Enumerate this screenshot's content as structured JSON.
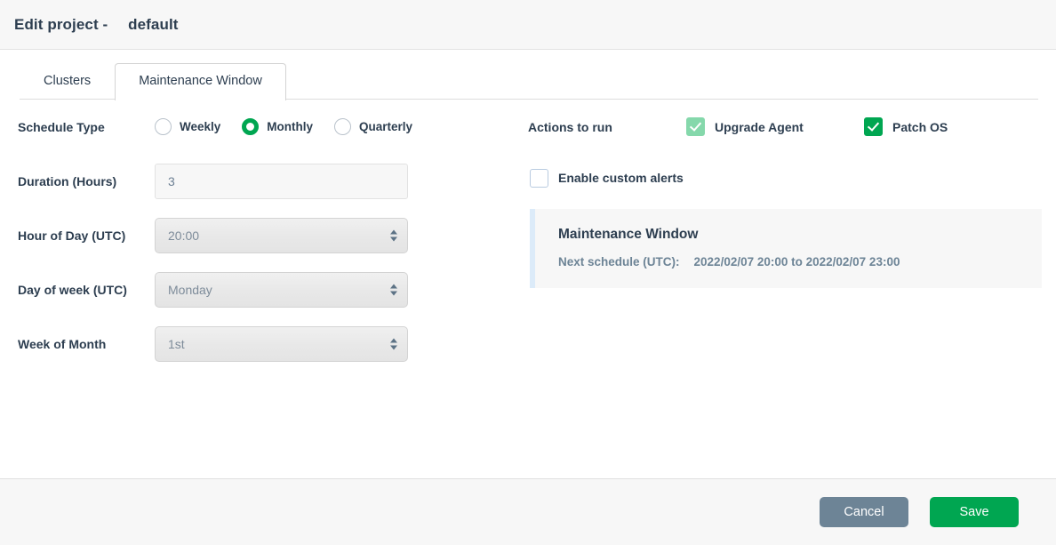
{
  "header": {
    "title_prefix": "Edit project -",
    "project_name": "default"
  },
  "tabs": [
    {
      "label": "Clusters",
      "active": false
    },
    {
      "label": "Maintenance Window",
      "active": true
    }
  ],
  "form": {
    "schedule_type": {
      "label": "Schedule Type",
      "options": [
        {
          "label": "Weekly",
          "selected": false
        },
        {
          "label": "Monthly",
          "selected": true
        },
        {
          "label": "Quarterly",
          "selected": false
        }
      ]
    },
    "duration": {
      "label": "Duration (Hours)",
      "value": "3"
    },
    "hour_of_day": {
      "label": "Hour of Day (UTC)",
      "value": "20:00"
    },
    "day_of_week": {
      "label": "Day of week (UTC)",
      "value": "Monday"
    },
    "week_of_month": {
      "label": "Week of Month",
      "value": "1st"
    }
  },
  "actions": {
    "label": "Actions to run",
    "items": [
      {
        "label": "Upgrade Agent",
        "checked": true,
        "muted": true
      },
      {
        "label": "Patch OS",
        "checked": true,
        "muted": false
      }
    ],
    "custom_alerts": {
      "label": "Enable custom alerts",
      "checked": false
    }
  },
  "info_panel": {
    "title": "Maintenance Window",
    "next_schedule_label": "Next schedule (UTC):",
    "next_schedule_value": "2022/02/07 20:00 to 2022/02/07 23:00"
  },
  "footer": {
    "cancel_label": "Cancel",
    "save_label": "Save"
  },
  "colors": {
    "accent_green": "#00a651",
    "muted_green": "#85d8ab",
    "cancel_gray": "#6d8496",
    "info_border": "#dcebf9",
    "text": "#2d3e50"
  }
}
